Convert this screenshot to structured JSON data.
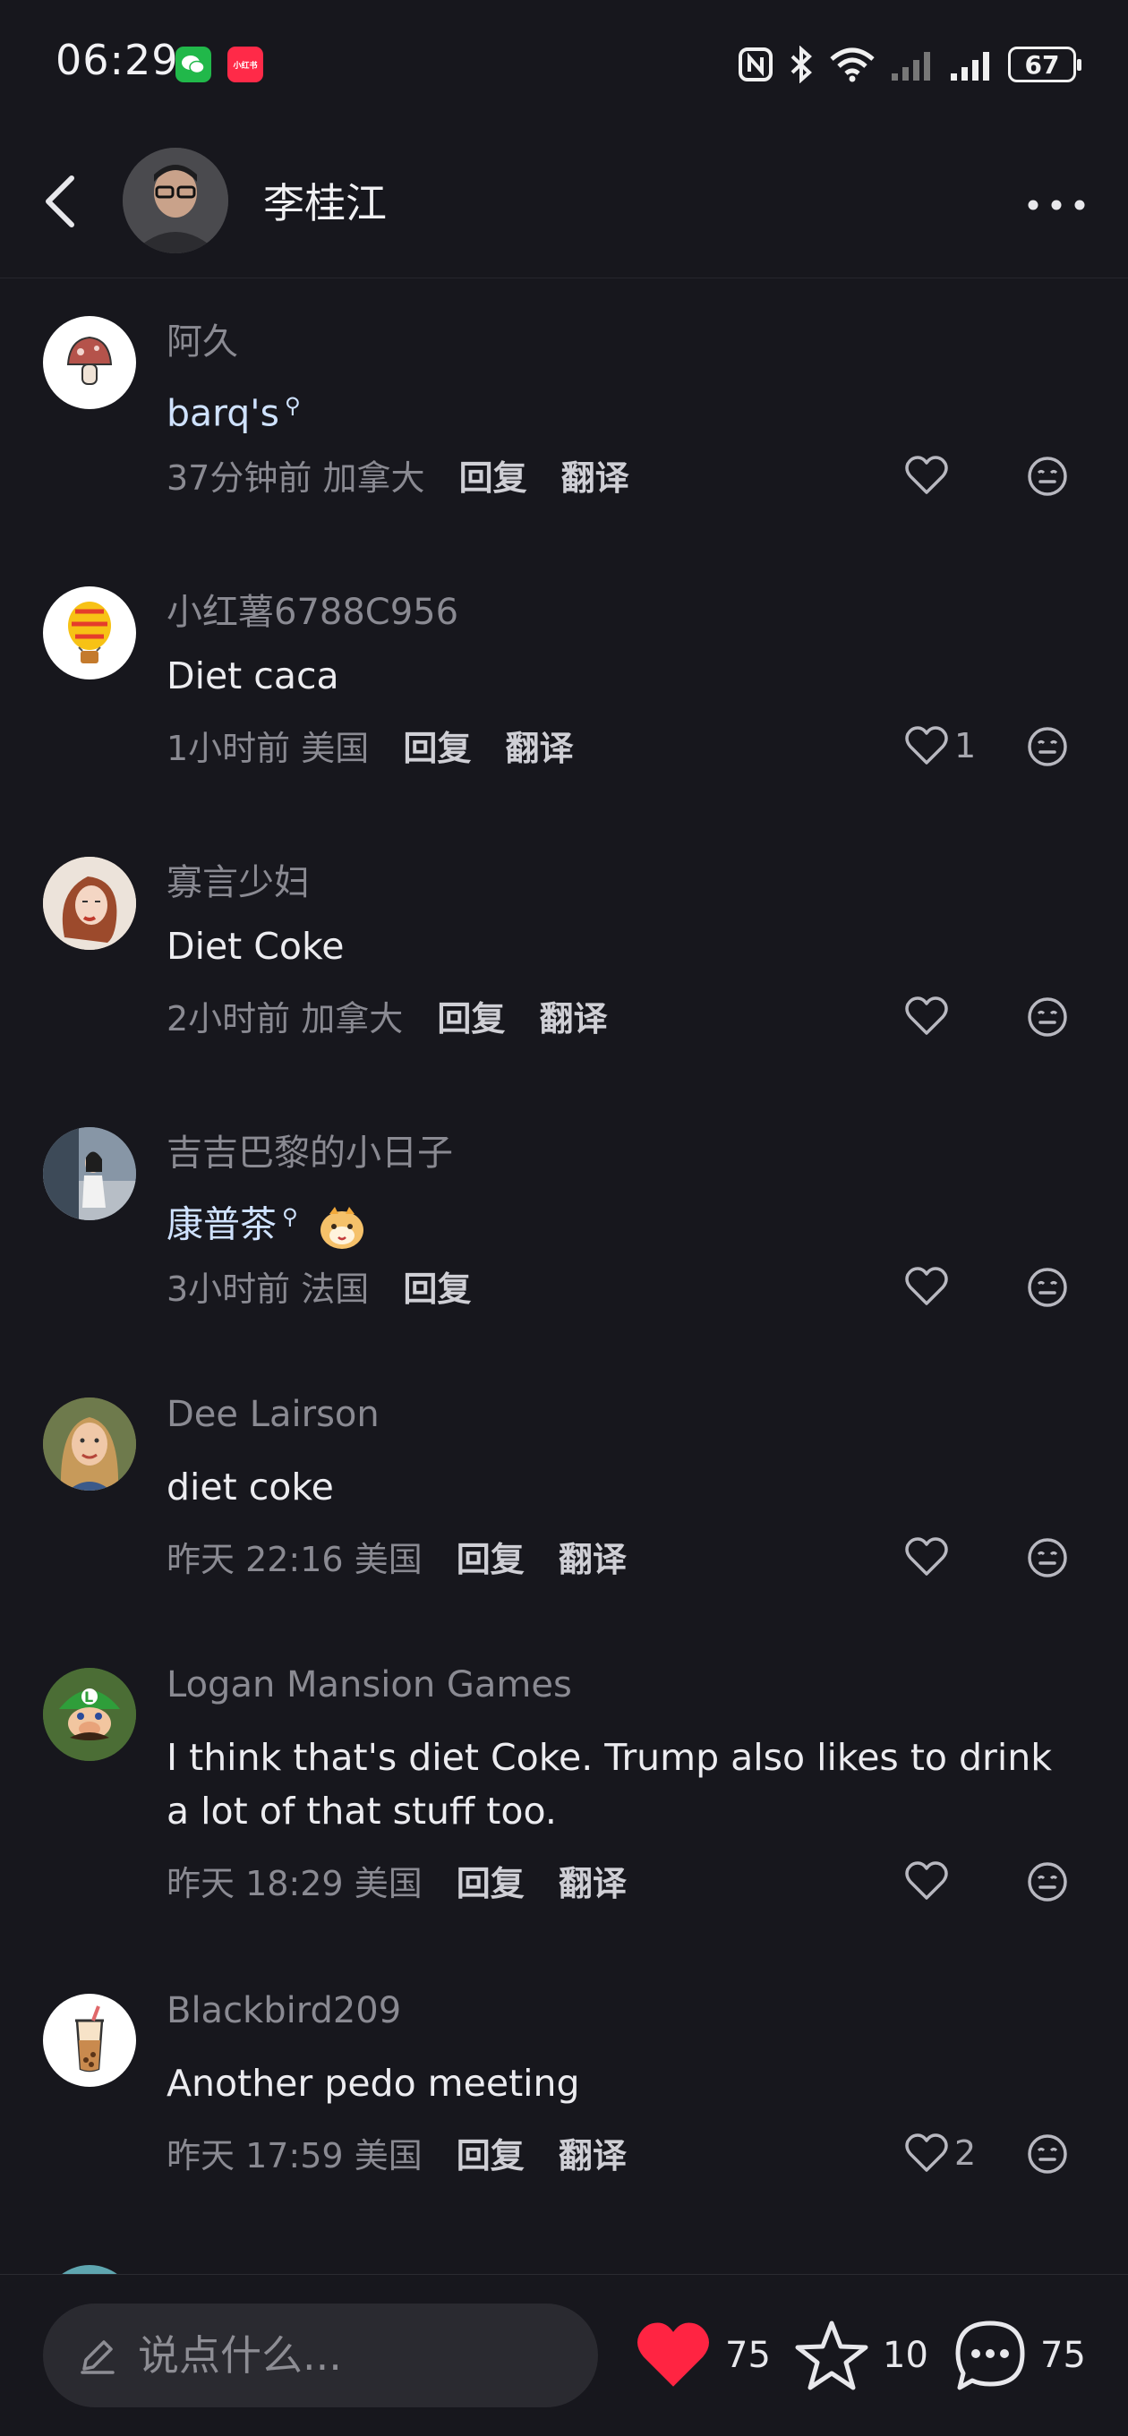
{
  "status_bar": {
    "time": "06:29",
    "badge_xhs": "小红书",
    "battery": "67"
  },
  "header": {
    "author_name": "李桂江"
  },
  "comments": [
    {
      "name": "阿久",
      "text": "barq's",
      "time": "37分钟前",
      "location": "加拿大",
      "reply": "回复",
      "translate": "翻译",
      "likes": ""
    },
    {
      "name": "小红薯6788C956",
      "text": "Diet caca",
      "time": "1小时前",
      "location": "美国",
      "reply": "回复",
      "translate": "翻译",
      "likes": "1"
    },
    {
      "name": "寡言少妇",
      "text": "Diet Coke",
      "time": "2小时前",
      "location": "加拿大",
      "reply": "回复",
      "translate": "翻译",
      "likes": ""
    },
    {
      "name": "吉吉巴黎的小日子",
      "text": "康普茶",
      "time": "3小时前",
      "location": "法国",
      "reply": "回复",
      "translate": "",
      "likes": ""
    },
    {
      "name": "Dee Lairson",
      "text": "diet coke",
      "time": "昨天 22:16",
      "location": "美国",
      "reply": "回复",
      "translate": "翻译",
      "likes": ""
    },
    {
      "name": "Logan Mansion Games",
      "text": "I think that's diet Coke. Trump also likes to drink a lot of that stuff too.",
      "time": "昨天 18:29",
      "location": "美国",
      "reply": "回复",
      "translate": "翻译",
      "likes": ""
    },
    {
      "name": "Blackbird209",
      "text": "Another pedo meeting",
      "time": "昨天 17:59",
      "location": "美国",
      "reply": "回复",
      "translate": "翻译",
      "likes": "2"
    }
  ],
  "bottom_bar": {
    "input_placeholder": "说点什么...",
    "like_count": "75",
    "collect_count": "10",
    "comment_count": "75"
  },
  "colors": {
    "background": "#17171d",
    "like_red": "#ff2442",
    "link": "#cfe2ff"
  }
}
